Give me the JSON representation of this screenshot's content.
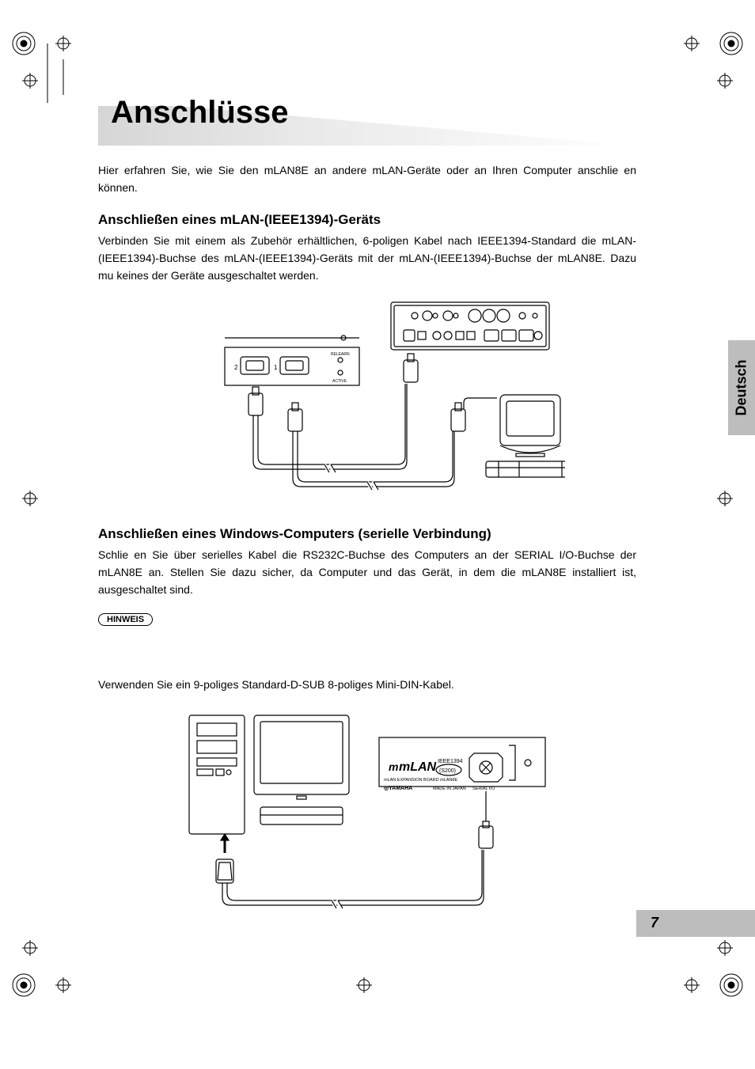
{
  "title": "Anschlüsse",
  "intro": "Hier erfahren Sie, wie Sie den mLAN8E an andere mLAN-Geräte oder an Ihren Computer anschlie en können.",
  "section1": {
    "heading": "Anschließen eines mLAN-(IEEE1394)-Geräts",
    "body": "Verbinden Sie mit einem als Zubehör erhältlichen, 6-poligen Kabel nach IEEE1394-Standard die mLAN-(IEEE1394)-Buchse des mLAN-(IEEE1394)-Geräts mit der mLAN-(IEEE1394)-Buchse der mLAN8E. Dazu mu  keines der Geräte ausgeschaltet werden."
  },
  "section2": {
    "heading": "Anschließen eines Windows-Computers (serielle Verbindung)",
    "body": "Schlie en Sie über serielles Kabel die RS232C-Buchse des Computers an der SERIAL I/O-Buchse der mLAN8E an. Stellen Sie dazu sicher, da  Computer und das Gerät, in dem die mLAN8E installiert ist, ausgeschaltet sind.",
    "hint_label": "HINWEIS",
    "cable_note": "Verwenden Sie ein 9-poliges Standard-D-SUB    8-poliges Mini-DIN-Kabel."
  },
  "figure1": {
    "labels": {
      "port1": "1",
      "port2": "2",
      "relearn": "RELEARN",
      "active": "ACTIVE"
    }
  },
  "figure2": {
    "labels": {
      "mlan": "mLAN",
      "ieee": "IEEE1394",
      "rate": "(S200)",
      "board": "mLAN EXPANSION BOARD mLAN8E",
      "yamaha": "◎YAMAHA",
      "made": "MADE IN JAPAN",
      "serial": "SERIAL I/O"
    }
  },
  "language_tab": "Deutsch",
  "page_number": "7"
}
